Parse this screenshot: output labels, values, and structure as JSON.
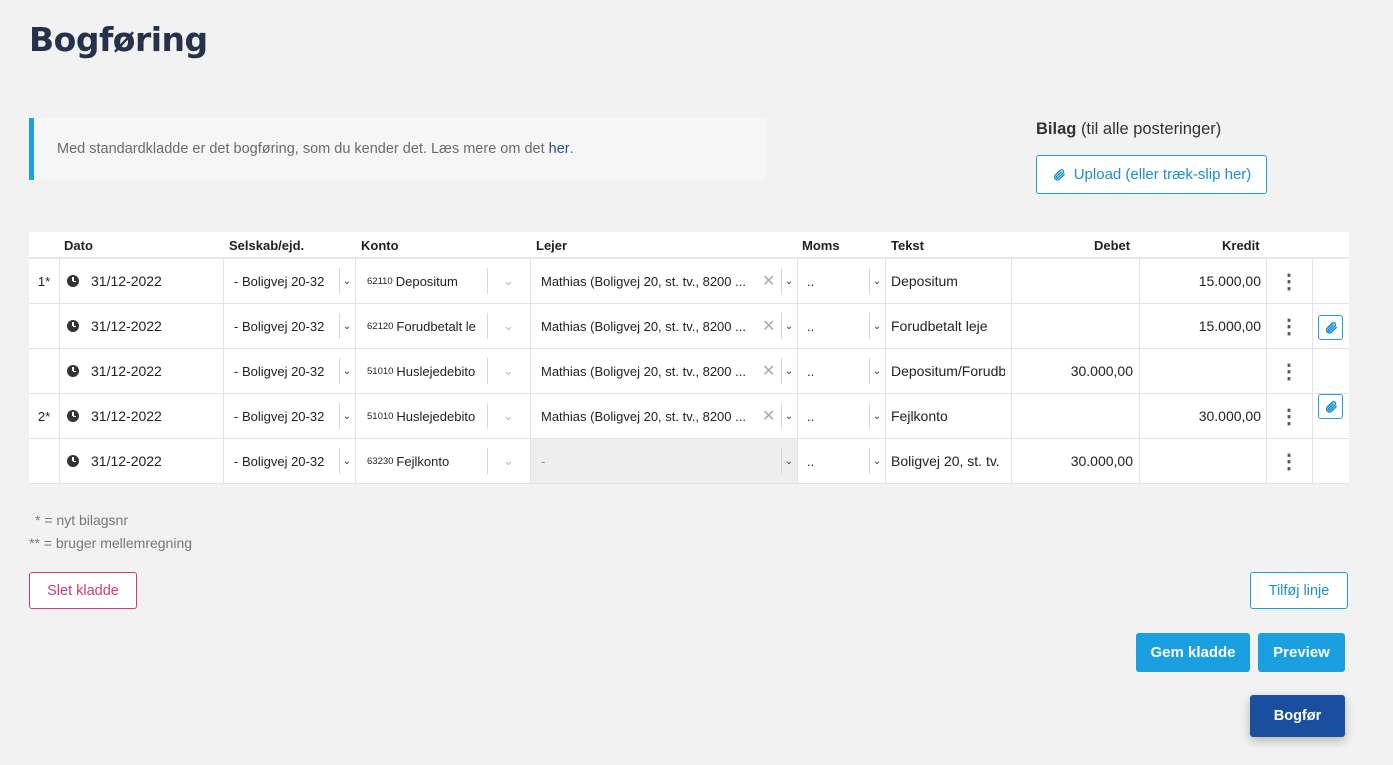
{
  "page": {
    "title": "Bogføring"
  },
  "info": {
    "text": "Med standardkladde er det bogføring, som du kender det. Læs mere om det",
    "link": "her",
    "suffix": "."
  },
  "bilag": {
    "title": "Bilag",
    "subtitle": "(til alle posteringer)",
    "upload_label": "Upload (eller træk-slip her)"
  },
  "columns": {
    "dato": "Dato",
    "selskab": "Selskab/ejd.",
    "konto": "Konto",
    "lejer": "Lejer",
    "moms": "Moms",
    "tekst": "Tekst",
    "debet": "Debet",
    "kredit": "Kredit"
  },
  "rows": [
    {
      "num": "1*",
      "date": "31/12-2022",
      "selskab": "- Boligvej 20-32",
      "konto_num": "62110",
      "konto_name": "Depositum",
      "lejer": "Mathias (Boligvej 20, st. tv., 8200 ...",
      "moms": "..",
      "tekst": "Depositum",
      "debet": "",
      "kredit": "15.000,00"
    },
    {
      "num": "",
      "date": "31/12-2022",
      "selskab": "- Boligvej 20-32",
      "konto_num": "62120",
      "konto_name": "Forudbetalt le",
      "lejer": "Mathias (Boligvej 20, st. tv., 8200 ...",
      "moms": "..",
      "tekst": "Forudbetalt leje",
      "debet": "",
      "kredit": "15.000,00"
    },
    {
      "num": "",
      "date": "31/12-2022",
      "selskab": "- Boligvej 20-32",
      "konto_num": "51010",
      "konto_name": "Huslejedebito",
      "lejer": "Mathias (Boligvej 20, st. tv., 8200 ...",
      "moms": "..",
      "tekst": "Depositum/Forudb",
      "debet": "30.000,00",
      "kredit": ""
    },
    {
      "num": "2*",
      "date": "31/12-2022",
      "selskab": "- Boligvej 20-32",
      "konto_num": "51010",
      "konto_name": "Huslejedebito",
      "lejer": "Mathias (Boligvej 20, st. tv., 8200 ...",
      "moms": "..",
      "tekst": "Fejlkonto",
      "debet": "",
      "kredit": "30.000,00"
    },
    {
      "num": "",
      "date": "31/12-2022",
      "selskab": "- Boligvej 20-32",
      "konto_num": "63230",
      "konto_name": "Fejlkonto",
      "lejer": "-",
      "moms": "..",
      "tekst": "Boligvej 20, st. tv.",
      "debet": "30.000,00",
      "kredit": ""
    }
  ],
  "legend": {
    "line1": "* = nyt bilagsnr",
    "line2": "** = bruger mellemregning"
  },
  "actions": {
    "delete": "Slet kladde",
    "add_line": "Tilføj linje",
    "save": "Gem kladde",
    "preview": "Preview",
    "post": "Bogfør"
  },
  "colors": {
    "accent": "#1a9fe0",
    "danger": "#d33b6c",
    "primary_dark": "#1a4fa0"
  }
}
